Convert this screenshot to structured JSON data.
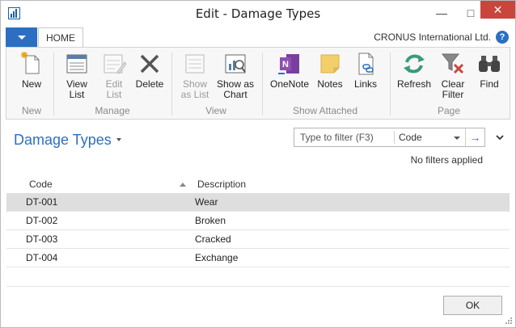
{
  "window": {
    "title": "Edit - Damage Types"
  },
  "tabs": {
    "home": "HOME"
  },
  "company": "CRONUS International Ltd.",
  "help_label": "?",
  "ribbon": {
    "new": "New",
    "view_list": [
      "View",
      "List"
    ],
    "edit_list": [
      "Edit",
      "List"
    ],
    "delete": "Delete",
    "show_as_list": [
      "Show",
      "as List"
    ],
    "show_as_chart": [
      "Show as",
      "Chart"
    ],
    "onenote": "OneNote",
    "notes": "Notes",
    "links": "Links",
    "refresh": "Refresh",
    "clear_filter": [
      "Clear",
      "Filter"
    ],
    "find": "Find",
    "groups": {
      "new": "New",
      "manage": "Manage",
      "view": "View",
      "show_attached": "Show Attached",
      "page": "Page"
    }
  },
  "page": {
    "title": "Damage Types"
  },
  "filter": {
    "placeholder": "Type to filter (F3)",
    "field": "Code",
    "status": "No filters applied"
  },
  "table": {
    "columns": {
      "code": "Code",
      "description": "Description"
    },
    "rows": [
      {
        "code": "DT-001",
        "description": "Wear"
      },
      {
        "code": "DT-002",
        "description": "Broken"
      },
      {
        "code": "DT-003",
        "description": "Cracked"
      },
      {
        "code": "DT-004",
        "description": "Exchange"
      }
    ]
  },
  "buttons": {
    "ok": "OK"
  },
  "colors": {
    "accent": "#2c6fc2",
    "close": "#c9463d",
    "selected_row": "#dedede"
  }
}
